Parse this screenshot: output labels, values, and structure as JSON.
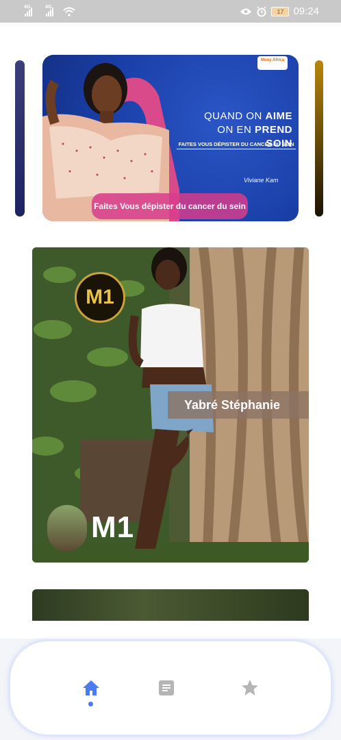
{
  "status_bar": {
    "signal1_label": "4G",
    "signal2_label": "4G",
    "battery": "17",
    "time": "09:24"
  },
  "banner": {
    "headline_line1_pre": "QUAND ON ",
    "headline_line1_bold": "AIME",
    "headline_line2_pre": "ON EN ",
    "headline_line2_bold": "PREND SOIN",
    "subline": "FAITES VOUS DÉPISTER DU CANCER DU SEIN",
    "signature": "Viviane Kam",
    "logo_text": "Mooy Africa",
    "caption": "Faites Vous dépister du cancer du sein"
  },
  "card": {
    "logo_text": "M1",
    "name": "Yabré Stéphanie",
    "bottom_label": "M1"
  },
  "nav": {
    "items": [
      {
        "icon": "home-icon",
        "active": true
      },
      {
        "icon": "document-icon",
        "active": false
      },
      {
        "icon": "star-icon",
        "active": false
      }
    ],
    "active_color": "#4a7cf0",
    "inactive_color": "#b5b5b5"
  }
}
